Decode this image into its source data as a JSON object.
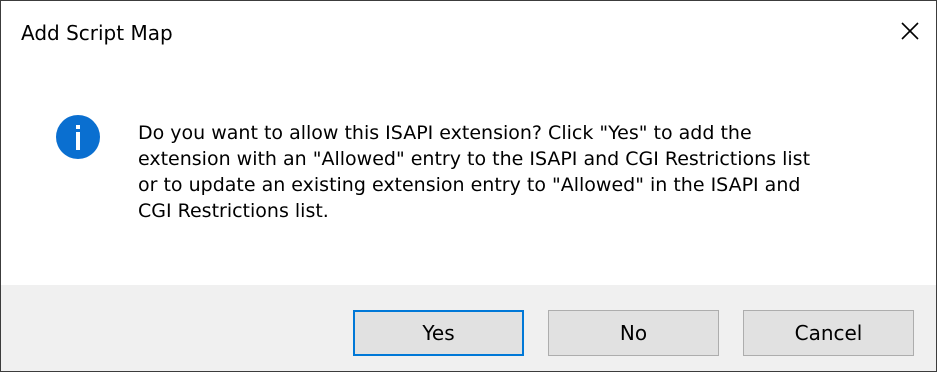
{
  "window": {
    "title": "Add Script Map",
    "close_icon": "close-icon"
  },
  "message": {
    "icon": "info-icon",
    "icon_color": "#0a6fd0",
    "text": "Do you want to allow this ISAPI extension? Click \"Yes\" to add the\nextension with an \"Allowed\" entry to the ISAPI and CGI Restrictions list\nor to update an existing extension entry to \"Allowed\" in the ISAPI and\nCGI Restrictions list."
  },
  "buttons": {
    "yes": "Yes",
    "no": "No",
    "cancel": "Cancel",
    "default_focus_color": "#0078d7"
  }
}
